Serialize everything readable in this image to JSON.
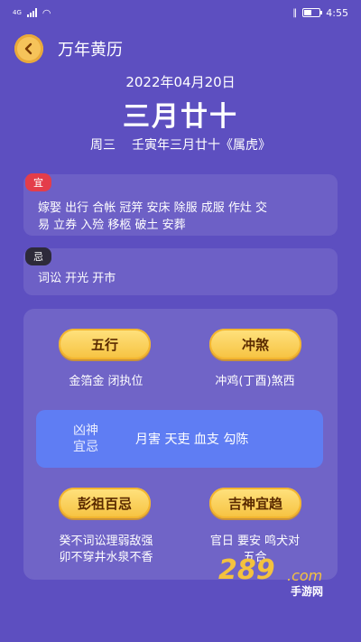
{
  "status": {
    "network": "4G",
    "time": "4:55",
    "battery_level": 0.5
  },
  "header": {
    "title": "万年黄历"
  },
  "date": {
    "gregorian": "2022年04月20日",
    "lunar_big": "三月廿十",
    "weekday": "周三",
    "lunar_full": "壬寅年三月廿十《属虎》"
  },
  "yi": {
    "tag": "宜",
    "line1": "嫁娶 出行 合帐 冠笄 安床 除服 成服 作灶 交",
    "line2": "易 立券 入殓 移柩 破土 安葬"
  },
  "ji": {
    "tag": "忌",
    "text": "词讼 开光 开市"
  },
  "wuxing": {
    "label": "五行",
    "value": "金箔金 闭执位"
  },
  "chongsha": {
    "label": "冲煞",
    "value": "冲鸡(丁酉)煞西"
  },
  "xiongshen": {
    "label_line1": "凶神",
    "label_line2": "宜忌",
    "value": "月害 天吏 血支 勾陈"
  },
  "pengzu": {
    "label": "彭祖百忌",
    "line1": "癸不词讼理弱敌强",
    "line2": "卯不穿井水泉不香"
  },
  "jishen": {
    "label": "吉神宜趋",
    "line1": "官日 要安 鸣犬对",
    "line2": "五合"
  },
  "watermark": {
    "num": "289",
    "com": ".com",
    "sub": "手游网"
  }
}
